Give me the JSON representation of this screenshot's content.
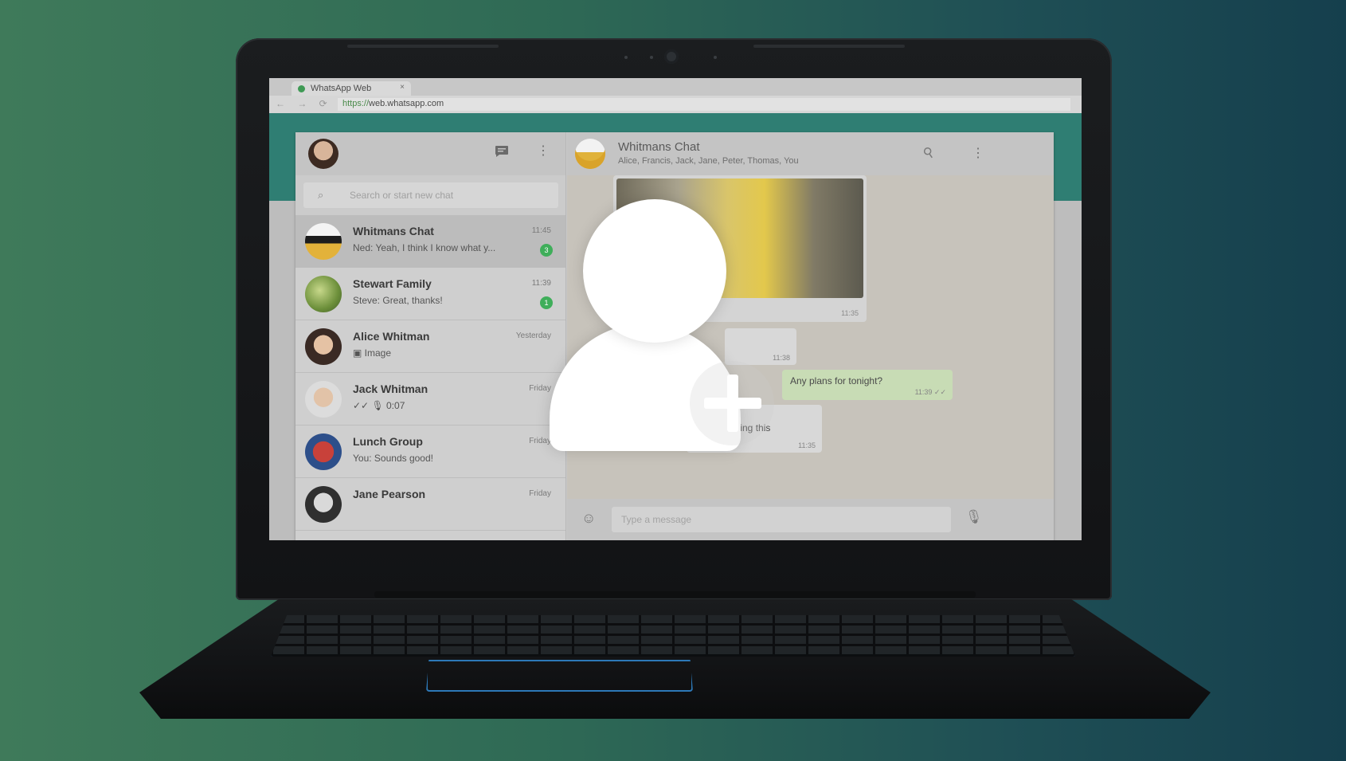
{
  "browser": {
    "tab_title": "WhatsApp Web",
    "tab_close": "×",
    "url_scheme": "https://",
    "url_host": "web.whatsapp.com",
    "nav_glyphs": "← → ⟳"
  },
  "sidebar": {
    "chat_icon": "chat-icon",
    "menu_glyph": "⋮",
    "search_placeholder": "Search or start new chat",
    "search_glyph": "⌕",
    "chats": [
      {
        "name": "Whitmans Chat",
        "preview": "Ned: Yeah, I think I know what y...",
        "time": "11:45",
        "unread": "3"
      },
      {
        "name": "Stewart Family",
        "preview": "Steve: Great, thanks!",
        "time": "11:39",
        "unread": "1"
      },
      {
        "name": "Alice Whitman",
        "preview": "▣ Image",
        "time": "Yesterday",
        "unread": ""
      },
      {
        "name": "Jack Whitman",
        "preview": "✓✓ 🎙 0:07",
        "time": "Friday",
        "unread": ""
      },
      {
        "name": "Lunch Group",
        "preview": "You: Sounds good!",
        "time": "Friday",
        "unread": ""
      },
      {
        "name": "Jane Pearson",
        "preview": "",
        "time": "Friday",
        "unread": ""
      }
    ]
  },
  "conversation": {
    "title": "Whitmans Chat",
    "members": "Alice, Francis, Jack, Jane, Peter, Thomas, You",
    "attach_glyph": "⚲",
    "menu_glyph": "⋮",
    "video_time": "11:35",
    "msg1_time": "11:38",
    "msg_out_text": "Any plans for tonight?",
    "msg_out_time": "11:39 ✓✓",
    "msg3_text": "I like s    ing this",
    "msg3_time": "11:35",
    "composer_placeholder": "Type a message",
    "emoji_glyph": "☺",
    "mic_glyph": "🎙"
  },
  "colors": {
    "background_left": "#3f7a5a",
    "background_right": "#153f4d",
    "whatsapp_teal": "#2f7e73",
    "unread_badge": "#3fae5a",
    "touchpad_accent": "#2d79b8"
  },
  "overlay": {
    "icon": "add-contact-icon"
  }
}
